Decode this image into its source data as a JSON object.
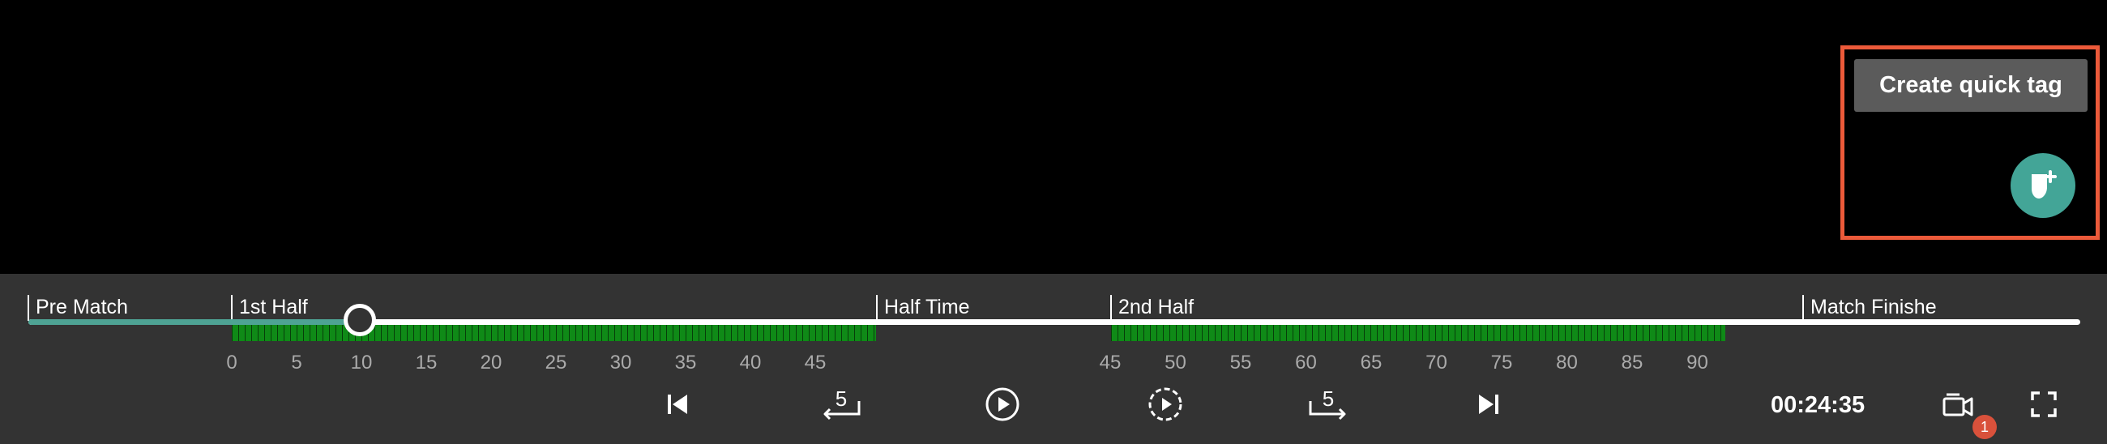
{
  "quick_tag": {
    "button_label": "Create quick tag",
    "fab_icon": "tag-plus-icon"
  },
  "colors": {
    "accent": "#43a597",
    "highlight": "#ec5a3a",
    "density": "#0f8a17",
    "badge": "#d9513b",
    "bar_background": "#333333"
  },
  "timeline": {
    "phases": [
      "Pre Match",
      "1st Half",
      "Half Time",
      "2nd Half",
      "Match Finishe"
    ],
    "first_half_ticks": [
      "0",
      "5",
      "10",
      "15",
      "20",
      "25",
      "30",
      "35",
      "40",
      "45"
    ],
    "second_half_ticks": [
      "45",
      "50",
      "55",
      "60",
      "65",
      "70",
      "75",
      "80",
      "85",
      "90"
    ]
  },
  "controls": {
    "skip_back_seconds": "5",
    "skip_forward_seconds": "5",
    "current_time": "00:24:35",
    "camera_badge_count": "1",
    "icons": [
      "skip-to-start-icon",
      "rewind-5-icon",
      "play-icon",
      "slow-motion-icon",
      "forward-5-icon",
      "skip-to-end-icon",
      "camera-switch-icon",
      "fullscreen-icon"
    ]
  }
}
